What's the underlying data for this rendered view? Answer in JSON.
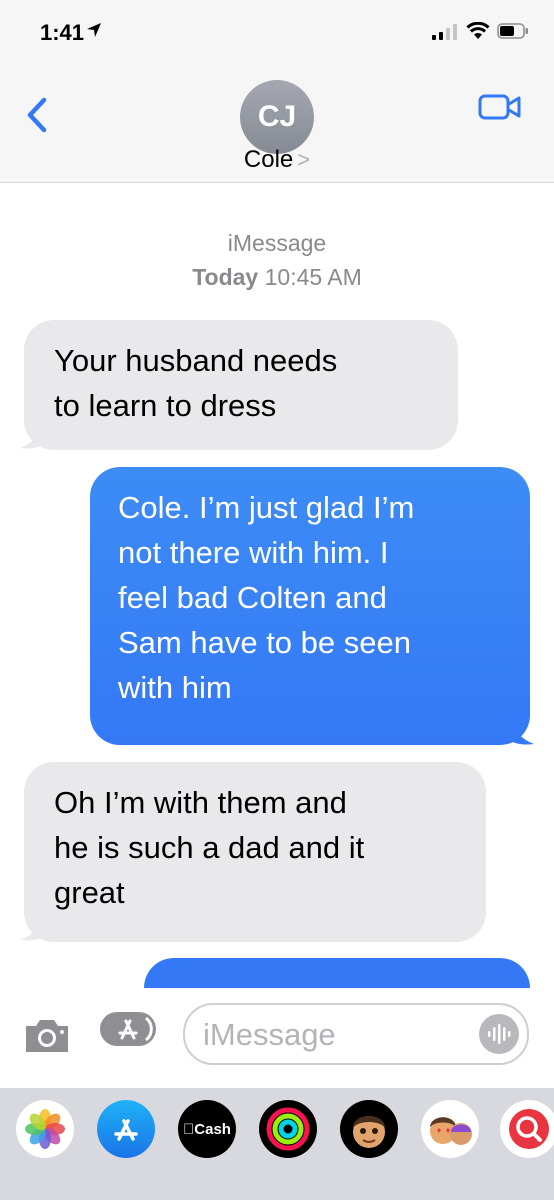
{
  "status_bar": {
    "time": "1:41"
  },
  "header": {
    "avatar_initials": "CJ",
    "contact_name": "Cole",
    "contact_chevron": ">"
  },
  "conversation": {
    "service": "iMessage",
    "timestamp_day": "Today",
    "timestamp_time": "10:45 AM",
    "messages": [
      {
        "direction": "received",
        "lines": [
          "Your husband needs",
          "to learn to dress"
        ]
      },
      {
        "direction": "sent",
        "lines": [
          "Cole. I’m just glad I’m",
          "not there with him. I",
          "feel bad Colten and",
          "Sam have to be seen",
          "with him"
        ]
      },
      {
        "direction": "received",
        "lines": [
          "Oh I’m with them and",
          "he is such a dad and it",
          "great"
        ]
      }
    ]
  },
  "compose": {
    "placeholder": "iMessage"
  },
  "app_drawer": {
    "apps": [
      {
        "name": "photos-icon"
      },
      {
        "name": "app-store-icon"
      },
      {
        "name": "apple-cash-icon",
        "label": "Cash"
      },
      {
        "name": "activity-icon"
      },
      {
        "name": "memoji-icon"
      },
      {
        "name": "memoji-stickers-icon"
      },
      {
        "name": "web-search-icon"
      }
    ]
  },
  "colors": {
    "accent": "#3478f6",
    "received_bubble": "#e9e9eb",
    "bar_background": "#f6f6f6",
    "drawer_background": "#d8d9de"
  }
}
